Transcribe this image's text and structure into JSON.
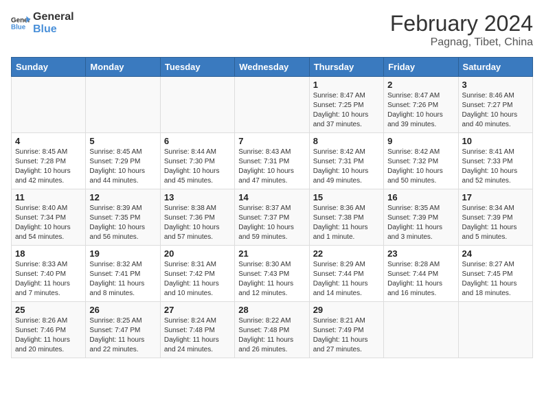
{
  "header": {
    "logo_line1": "General",
    "logo_line2": "Blue",
    "title": "February 2024",
    "subtitle": "Pagnag, Tibet, China"
  },
  "days_of_week": [
    "Sunday",
    "Monday",
    "Tuesday",
    "Wednesday",
    "Thursday",
    "Friday",
    "Saturday"
  ],
  "weeks": [
    [
      {
        "day": "",
        "info": ""
      },
      {
        "day": "",
        "info": ""
      },
      {
        "day": "",
        "info": ""
      },
      {
        "day": "",
        "info": ""
      },
      {
        "day": "1",
        "info": "Sunrise: 8:47 AM\nSunset: 7:25 PM\nDaylight: 10 hours\nand 37 minutes."
      },
      {
        "day": "2",
        "info": "Sunrise: 8:47 AM\nSunset: 7:26 PM\nDaylight: 10 hours\nand 39 minutes."
      },
      {
        "day": "3",
        "info": "Sunrise: 8:46 AM\nSunset: 7:27 PM\nDaylight: 10 hours\nand 40 minutes."
      }
    ],
    [
      {
        "day": "4",
        "info": "Sunrise: 8:45 AM\nSunset: 7:28 PM\nDaylight: 10 hours\nand 42 minutes."
      },
      {
        "day": "5",
        "info": "Sunrise: 8:45 AM\nSunset: 7:29 PM\nDaylight: 10 hours\nand 44 minutes."
      },
      {
        "day": "6",
        "info": "Sunrise: 8:44 AM\nSunset: 7:30 PM\nDaylight: 10 hours\nand 45 minutes."
      },
      {
        "day": "7",
        "info": "Sunrise: 8:43 AM\nSunset: 7:31 PM\nDaylight: 10 hours\nand 47 minutes."
      },
      {
        "day": "8",
        "info": "Sunrise: 8:42 AM\nSunset: 7:31 PM\nDaylight: 10 hours\nand 49 minutes."
      },
      {
        "day": "9",
        "info": "Sunrise: 8:42 AM\nSunset: 7:32 PM\nDaylight: 10 hours\nand 50 minutes."
      },
      {
        "day": "10",
        "info": "Sunrise: 8:41 AM\nSunset: 7:33 PM\nDaylight: 10 hours\nand 52 minutes."
      }
    ],
    [
      {
        "day": "11",
        "info": "Sunrise: 8:40 AM\nSunset: 7:34 PM\nDaylight: 10 hours\nand 54 minutes."
      },
      {
        "day": "12",
        "info": "Sunrise: 8:39 AM\nSunset: 7:35 PM\nDaylight: 10 hours\nand 56 minutes."
      },
      {
        "day": "13",
        "info": "Sunrise: 8:38 AM\nSunset: 7:36 PM\nDaylight: 10 hours\nand 57 minutes."
      },
      {
        "day": "14",
        "info": "Sunrise: 8:37 AM\nSunset: 7:37 PM\nDaylight: 10 hours\nand 59 minutes."
      },
      {
        "day": "15",
        "info": "Sunrise: 8:36 AM\nSunset: 7:38 PM\nDaylight: 11 hours\nand 1 minute."
      },
      {
        "day": "16",
        "info": "Sunrise: 8:35 AM\nSunset: 7:39 PM\nDaylight: 11 hours\nand 3 minutes."
      },
      {
        "day": "17",
        "info": "Sunrise: 8:34 AM\nSunset: 7:39 PM\nDaylight: 11 hours\nand 5 minutes."
      }
    ],
    [
      {
        "day": "18",
        "info": "Sunrise: 8:33 AM\nSunset: 7:40 PM\nDaylight: 11 hours\nand 7 minutes."
      },
      {
        "day": "19",
        "info": "Sunrise: 8:32 AM\nSunset: 7:41 PM\nDaylight: 11 hours\nand 8 minutes."
      },
      {
        "day": "20",
        "info": "Sunrise: 8:31 AM\nSunset: 7:42 PM\nDaylight: 11 hours\nand 10 minutes."
      },
      {
        "day": "21",
        "info": "Sunrise: 8:30 AM\nSunset: 7:43 PM\nDaylight: 11 hours\nand 12 minutes."
      },
      {
        "day": "22",
        "info": "Sunrise: 8:29 AM\nSunset: 7:44 PM\nDaylight: 11 hours\nand 14 minutes."
      },
      {
        "day": "23",
        "info": "Sunrise: 8:28 AM\nSunset: 7:44 PM\nDaylight: 11 hours\nand 16 minutes."
      },
      {
        "day": "24",
        "info": "Sunrise: 8:27 AM\nSunset: 7:45 PM\nDaylight: 11 hours\nand 18 minutes."
      }
    ],
    [
      {
        "day": "25",
        "info": "Sunrise: 8:26 AM\nSunset: 7:46 PM\nDaylight: 11 hours\nand 20 minutes."
      },
      {
        "day": "26",
        "info": "Sunrise: 8:25 AM\nSunset: 7:47 PM\nDaylight: 11 hours\nand 22 minutes."
      },
      {
        "day": "27",
        "info": "Sunrise: 8:24 AM\nSunset: 7:48 PM\nDaylight: 11 hours\nand 24 minutes."
      },
      {
        "day": "28",
        "info": "Sunrise: 8:22 AM\nSunset: 7:48 PM\nDaylight: 11 hours\nand 26 minutes."
      },
      {
        "day": "29",
        "info": "Sunrise: 8:21 AM\nSunset: 7:49 PM\nDaylight: 11 hours\nand 27 minutes."
      },
      {
        "day": "",
        "info": ""
      },
      {
        "day": "",
        "info": ""
      }
    ]
  ]
}
